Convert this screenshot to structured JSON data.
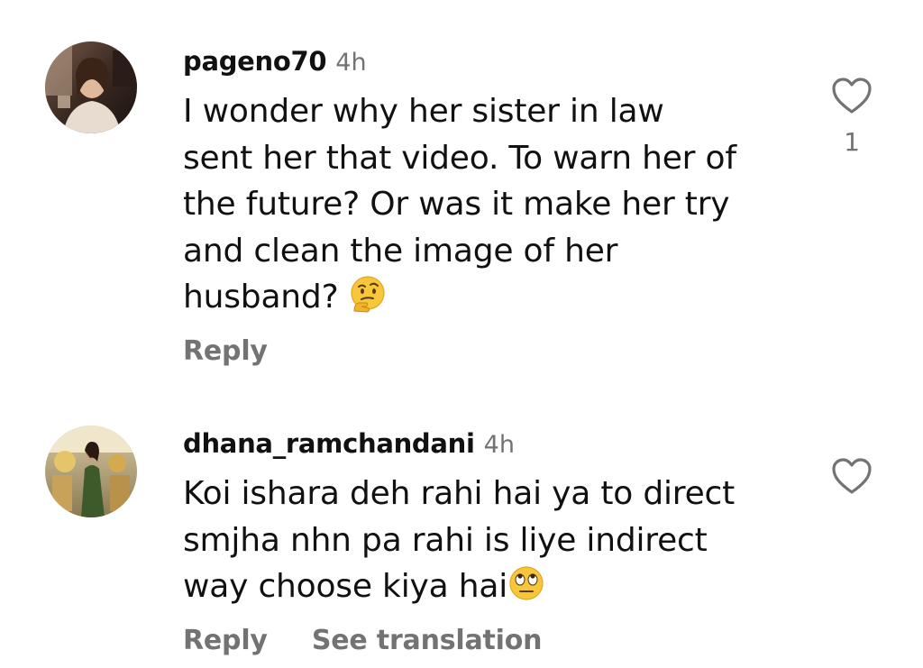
{
  "comments": [
    {
      "username": "pageno70",
      "time": "4h",
      "text": "I wonder why her sister in law sent her that video. To warn her of the future? Or was it make her try and clean the image of her husband?",
      "emoji": "thinking-face",
      "like_count": "1",
      "actions": {
        "reply": "Reply"
      }
    },
    {
      "username": "dhana_ramchandani",
      "time": "4h",
      "text": "Koi ishara deh rahi hai ya to direct smjha nhn pa rahi is liye indirect way choose kiya hai",
      "emoji": "face-with-rolling-eyes",
      "like_count": "",
      "actions": {
        "reply": "Reply",
        "translate": "See translation"
      }
    }
  ],
  "colors": {
    "text": "#111111",
    "secondary": "#737373",
    "background": "#ffffff"
  }
}
